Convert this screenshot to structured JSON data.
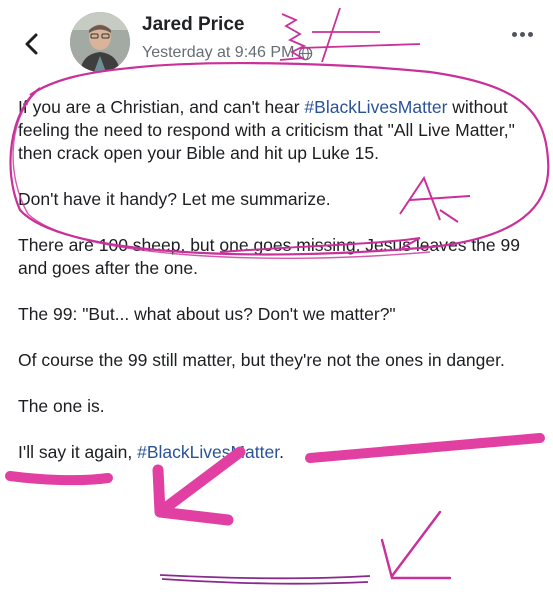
{
  "post": {
    "author": "Jared Price",
    "timestamp": "Yesterday at 9:46 PM",
    "privacy_icon": "globe-icon",
    "paragraphs": [
      {
        "before": "If you are a Christian, and can't hear ",
        "hashtag": "#BlackLivesMatter",
        "after": " without feeling the need to respond with a criticism that \"All Live Matter,\" then crack open your Bible and hit up Luke 15."
      },
      {
        "text": "Don't have it handy?  Let me summarize."
      },
      {
        "text": "There are 100 sheep, but one goes missing. Jesus leaves the 99 and goes after the one."
      },
      {
        "text": "The 99: \"But... what about us? Don't we matter?\""
      },
      {
        "text": "Of course the 99 still matter, but they're not the ones in danger."
      },
      {
        "text": "The one is."
      },
      {
        "before": "I'll say it again, ",
        "hashtag": "#BlackLivesMatter",
        "after": "."
      }
    ]
  },
  "icons": {
    "back": "chevron-left-icon",
    "more": "more-horizontal-icon"
  },
  "colors": {
    "hashtag": "#2a5298",
    "annotation_marker": "#c9309a",
    "highlight_marker": "#e23fa3",
    "arrow_marker": "#8a2a8e"
  }
}
